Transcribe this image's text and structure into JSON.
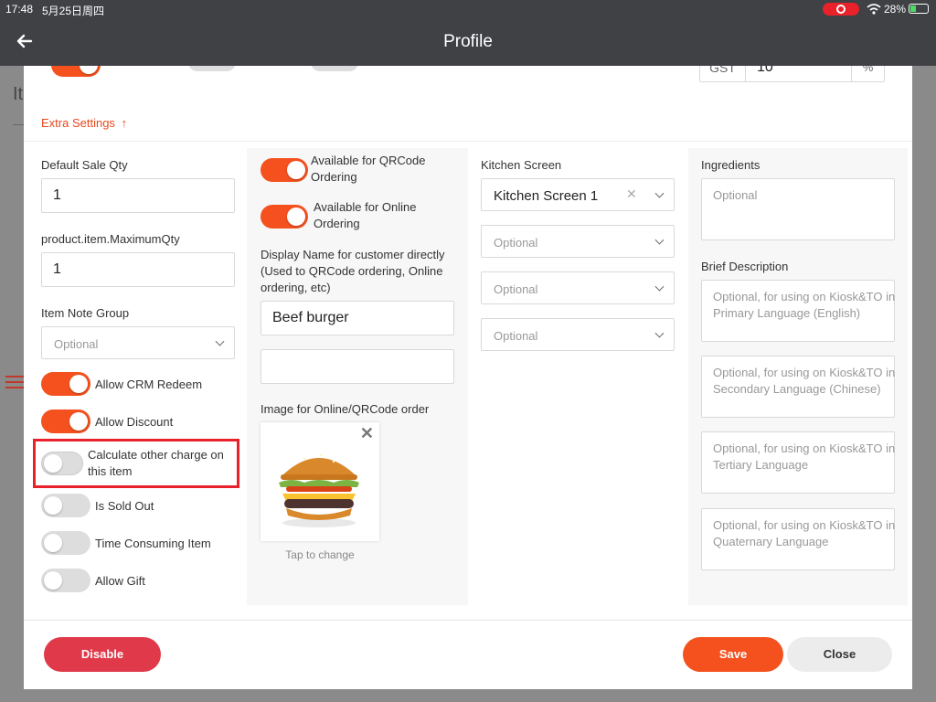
{
  "status_bar": {
    "time": "17:48",
    "date": "5月25日周四",
    "battery": "28%"
  },
  "navbar": {
    "title": "Profile"
  },
  "background": {
    "partial_title": "It"
  },
  "top_strip": {
    "gst_label": "GST",
    "gst_value": "10",
    "gst_unit": "%"
  },
  "extra_settings": {
    "label": "Extra Settings",
    "arrow": "↑"
  },
  "col1": {
    "default_sale_qty": {
      "label": "Default Sale Qty",
      "value": "1"
    },
    "maximum_qty": {
      "label": "product.item.MaximumQty",
      "value": "1"
    },
    "item_note_group": {
      "label": "Item Note Group",
      "placeholder": "Optional"
    },
    "toggles": [
      {
        "label": "Allow CRM Redeem",
        "on": true
      },
      {
        "label": "Allow Discount",
        "on": true
      },
      {
        "label": "Calculate other charge on this item",
        "on": false,
        "highlighted": true
      },
      {
        "label": "Is Sold Out",
        "on": false
      },
      {
        "label": "Time Consuming Item",
        "on": false
      },
      {
        "label": "Allow Gift",
        "on": false
      }
    ]
  },
  "col2": {
    "qr_toggle": {
      "label": "Available for QRCode Ordering",
      "on": true
    },
    "online_toggle": {
      "label": "Available for Online Ordering",
      "on": true
    },
    "display_name_label": "Display Name for customer directly (Used to QRCode ordering, Online ordering, etc)",
    "display_name_value": "Beef burger",
    "display_name_secondary": "",
    "image_label": "Image for Online/QRCode order",
    "tap_to_change": "Tap to change"
  },
  "col3": {
    "kitchen_label": "Kitchen Screen",
    "kitchen_value": "Kitchen Screen 1",
    "optional_selects": [
      "Optional",
      "Optional",
      "Optional"
    ]
  },
  "col4": {
    "ingredients_label": "Ingredients",
    "ingredients_placeholder": "Optional",
    "brief_label": "Brief Description",
    "descriptions": [
      "Optional, for using on Kiosk&TO in Primary Language (English)",
      "Optional, for using on Kiosk&TO in Secondary Language (Chinese)",
      "Optional, for using on Kiosk&TO in Tertiary Language",
      "Optional, for using on Kiosk&TO in Quaternary Language"
    ]
  },
  "footer": {
    "disable": "Disable",
    "save": "Save",
    "close": "Close"
  },
  "colors": {
    "accent": "#f4511e",
    "danger": "#e03a4a",
    "highlight": "#e8212b",
    "header": "#3f4145"
  }
}
